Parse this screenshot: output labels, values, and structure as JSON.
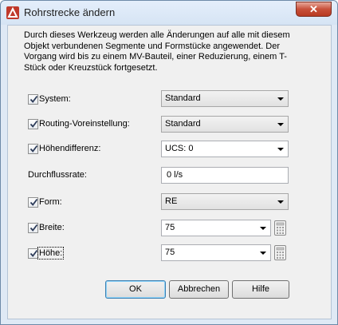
{
  "window": {
    "title": "Rohrstrecke ändern",
    "close_label": "✕"
  },
  "description": "Durch dieses Werkzeug werden alle Änderungen auf alle mit diesem Objekt verbundenen Segmente und Formstücke angewendet. Der Vorgang wird bis zu einem MV-Bauteil, einer Reduzierung, einem T-Stück oder Kreuzstück fortgesetzt.",
  "fields": {
    "system": {
      "label": "System:",
      "value": "Standard",
      "checked": true
    },
    "routing": {
      "label": "Routing-Voreinstellung:",
      "value": "Standard",
      "checked": true
    },
    "hoehendifferenz": {
      "label": "Höhendifferenz:",
      "value": "UCS: 0",
      "checked": true
    },
    "durchflussrate": {
      "label": "Durchflussrate:",
      "value": "0 l/s"
    },
    "form": {
      "label": "Form:",
      "value": "RE",
      "checked": true
    },
    "breite": {
      "label": "Breite:",
      "value": "75",
      "checked": true
    },
    "hoehe": {
      "label": "Höhe:",
      "value": "75",
      "checked": true
    }
  },
  "buttons": {
    "ok": "OK",
    "cancel": "Abbrechen",
    "help": "Hilfe"
  },
  "colors": {
    "accent": "#3c7fb1",
    "titlebar": "#dfe9f5",
    "close": "#c8503a"
  }
}
